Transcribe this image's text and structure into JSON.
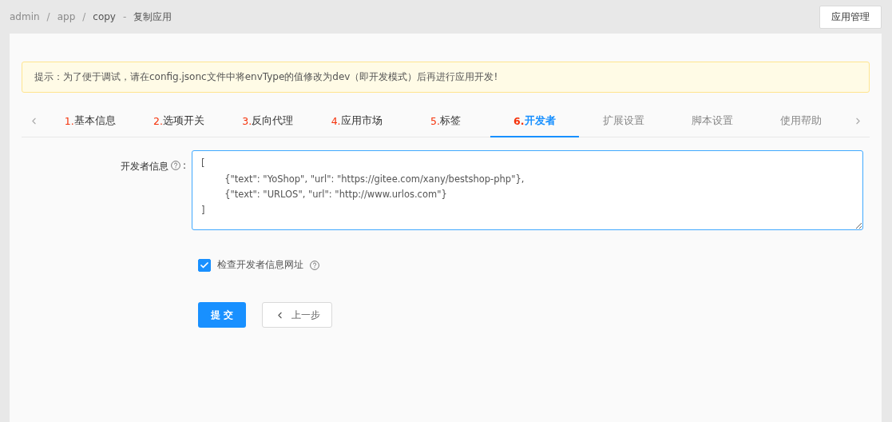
{
  "breadcrumb": [
    {
      "label": "admin",
      "current": false
    },
    {
      "label": "app",
      "current": false
    },
    {
      "label": "copy",
      "current": true
    }
  ],
  "breadcrumb_separator": "/",
  "title_separator": "-",
  "page_title": "复制应用",
  "header_button": "应用管理",
  "alert": "提示：为了便于调试，请在config.jsonc文件中将envType的值修改为dev（即开发模式）后再进行应用开发!",
  "tabs": [
    {
      "number": "1.",
      "label": "基本信息",
      "selected": false
    },
    {
      "number": "2.",
      "label": "选项开关",
      "selected": false
    },
    {
      "number": "3.",
      "label": "反向代理",
      "selected": false
    },
    {
      "number": "4.",
      "label": "应用市场",
      "selected": false
    },
    {
      "number": "5.",
      "label": "标签",
      "selected": false
    },
    {
      "number": "6.",
      "label": "开发者",
      "selected": true
    },
    {
      "label": "扩展设置",
      "selected": false
    },
    {
      "label": "脚本设置",
      "selected": false
    },
    {
      "label": "使用帮助",
      "selected": false
    }
  ],
  "form": {
    "label": "开发者信息",
    "label_suffix": ":",
    "value": "[\n\t{\"text\": \"YoShop\", \"url\": \"https://gitee.com/xany/bestshop-php\"},\n\t{\"text\": \"URLOS\", \"url\": \"http://www.urlos.com\"}\n]",
    "checkbox": {
      "label": "检查开发者信息网址",
      "checked": true
    }
  },
  "buttons": {
    "submit": "提 交",
    "back": "上一步"
  }
}
